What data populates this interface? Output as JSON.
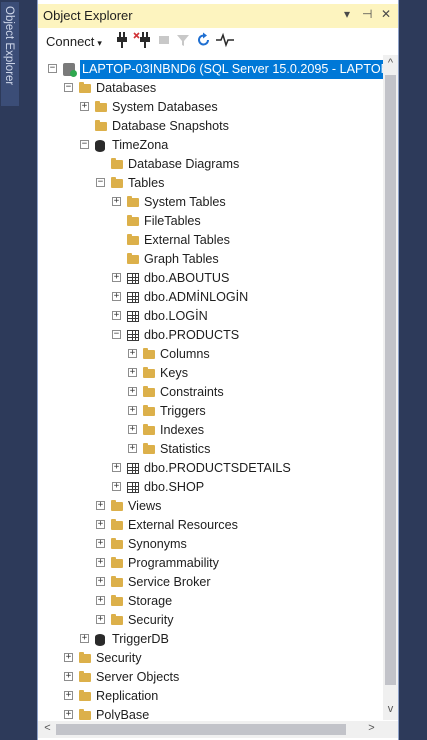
{
  "side_tab": {
    "label": "Object Explorer"
  },
  "title_bar": {
    "title": "Object Explorer",
    "pin_glyph": "▾",
    "dock_glyph": "⊣",
    "close_glyph": "✕"
  },
  "toolbar": {
    "connect_label": "Connect",
    "connect_caret": "▾"
  },
  "tree": {
    "nodes": [
      {
        "label": "LAPTOP-03INBND6 (SQL Server 15.0.2095 - LAPTOP-03INBND6\\",
        "level": 0,
        "icon": "server-icon",
        "expander": "−",
        "selected": true
      },
      {
        "label": "Databases",
        "level": 1,
        "icon": "folder-icon",
        "expander": "−"
      },
      {
        "label": "System Databases",
        "level": 2,
        "icon": "folder-icon",
        "expander": "+"
      },
      {
        "label": "Database Snapshots",
        "level": 2,
        "icon": "folder-icon",
        "expander": ""
      },
      {
        "label": "TimeZona",
        "level": 2,
        "icon": "database-icon",
        "expander": "−"
      },
      {
        "label": "Database Diagrams",
        "level": 3,
        "icon": "folder-icon",
        "expander": ""
      },
      {
        "label": "Tables",
        "level": 3,
        "icon": "folder-icon",
        "expander": "−"
      },
      {
        "label": "System Tables",
        "level": 4,
        "icon": "folder-icon",
        "expander": "+"
      },
      {
        "label": "FileTables",
        "level": 4,
        "icon": "folder-icon",
        "expander": ""
      },
      {
        "label": "External Tables",
        "level": 4,
        "icon": "folder-icon",
        "expander": ""
      },
      {
        "label": "Graph Tables",
        "level": 4,
        "icon": "folder-icon",
        "expander": ""
      },
      {
        "label": "dbo.ABOUTUS",
        "level": 4,
        "icon": "table-icon",
        "expander": "+"
      },
      {
        "label": "dbo.ADMİNLOGİN",
        "level": 4,
        "icon": "table-icon",
        "expander": "+"
      },
      {
        "label": "dbo.LOGİN",
        "level": 4,
        "icon": "table-icon",
        "expander": "+"
      },
      {
        "label": "dbo.PRODUCTS",
        "level": 4,
        "icon": "table-icon",
        "expander": "−"
      },
      {
        "label": "Columns",
        "level": 5,
        "icon": "folder-icon",
        "expander": "+"
      },
      {
        "label": "Keys",
        "level": 5,
        "icon": "folder-icon",
        "expander": "+"
      },
      {
        "label": "Constraints",
        "level": 5,
        "icon": "folder-icon",
        "expander": "+"
      },
      {
        "label": "Triggers",
        "level": 5,
        "icon": "folder-icon",
        "expander": "+"
      },
      {
        "label": "Indexes",
        "level": 5,
        "icon": "folder-icon",
        "expander": "+"
      },
      {
        "label": "Statistics",
        "level": 5,
        "icon": "folder-icon",
        "expander": "+"
      },
      {
        "label": "dbo.PRODUCTSDETAILS",
        "level": 4,
        "icon": "table-icon",
        "expander": "+"
      },
      {
        "label": "dbo.SHOP",
        "level": 4,
        "icon": "table-icon",
        "expander": "+"
      },
      {
        "label": "Views",
        "level": 3,
        "icon": "folder-icon",
        "expander": "+"
      },
      {
        "label": "External Resources",
        "level": 3,
        "icon": "folder-icon",
        "expander": "+"
      },
      {
        "label": "Synonyms",
        "level": 3,
        "icon": "folder-icon",
        "expander": "+"
      },
      {
        "label": "Programmability",
        "level": 3,
        "icon": "folder-icon",
        "expander": "+"
      },
      {
        "label": "Service Broker",
        "level": 3,
        "icon": "folder-icon",
        "expander": "+"
      },
      {
        "label": "Storage",
        "level": 3,
        "icon": "folder-icon",
        "expander": "+"
      },
      {
        "label": "Security",
        "level": 3,
        "icon": "folder-icon",
        "expander": "+"
      },
      {
        "label": "TriggerDB",
        "level": 2,
        "icon": "database-icon",
        "expander": "+"
      },
      {
        "label": "Security",
        "level": 1,
        "icon": "folder-icon",
        "expander": "+"
      },
      {
        "label": "Server Objects",
        "level": 1,
        "icon": "folder-icon",
        "expander": "+"
      },
      {
        "label": "Replication",
        "level": 1,
        "icon": "folder-icon",
        "expander": "+"
      },
      {
        "label": "PolyBase",
        "level": 1,
        "icon": "folder-icon",
        "expander": "+"
      }
    ]
  },
  "scrollbars": {
    "up": "^",
    "down": "v",
    "left": "<",
    "right": ">"
  },
  "colors": {
    "accent_selected": "#0078d7",
    "title_bar": "#fdf4bf",
    "frame": "#2d3a5a",
    "folder": "#dcb04a",
    "refresh": "#1f6fd1"
  }
}
